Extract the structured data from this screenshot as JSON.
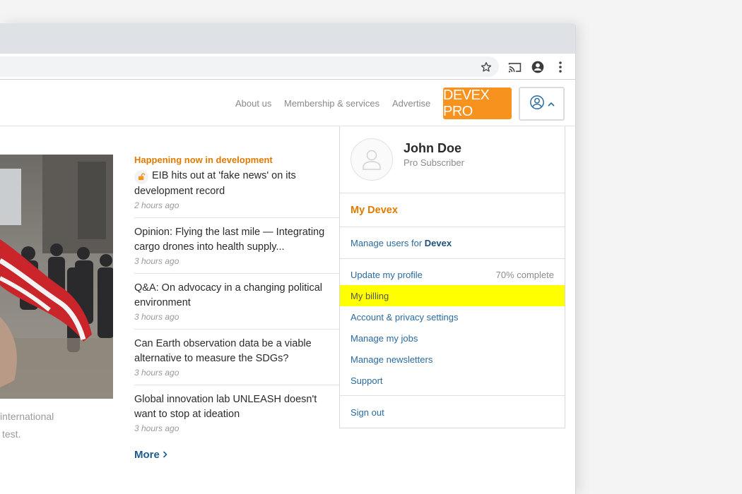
{
  "nav": {
    "about": "About us",
    "membership": "Membership & services",
    "advertise": "Advertise",
    "pro_button": "DEVEX PRO"
  },
  "hero": {
    "caption_line1": "international",
    "caption_line2": "test."
  },
  "news": {
    "heading": "Happening now in development",
    "items": [
      {
        "title": "EIB hits out at 'fake news' on its development record",
        "time": "2 hours ago"
      },
      {
        "title": "Opinion: Flying the last mile — Integrating cargo drones into health supply...",
        "time": "3 hours ago"
      },
      {
        "title": "Q&A: On advocacy in a changing political environment",
        "time": "3 hours ago"
      },
      {
        "title": "Can Earth observation data be a viable alternative to measure the SDGs?",
        "time": "3 hours ago"
      },
      {
        "title": "Global innovation lab UNLEASH doesn't want to stop at ideation",
        "time": "3 hours ago"
      }
    ],
    "more": "More"
  },
  "user_menu": {
    "name": "John Doe",
    "role": "Pro Subscriber",
    "my_devex": "My Devex",
    "manage_users_prefix": "Manage users for",
    "manage_users_org": "Devex",
    "update_profile": "Update my profile",
    "profile_completion": "70% complete",
    "billing": "My billing",
    "account_privacy": "Account & privacy settings",
    "manage_jobs": "Manage my jobs",
    "manage_newsletters": "Manage newsletters",
    "support": "Support",
    "sign_out": "Sign out"
  },
  "colors": {
    "accent_orange": "#f7921e",
    "heading_orange": "#e07b00",
    "link_blue": "#2a6a9e",
    "highlight": "#ffff00"
  }
}
